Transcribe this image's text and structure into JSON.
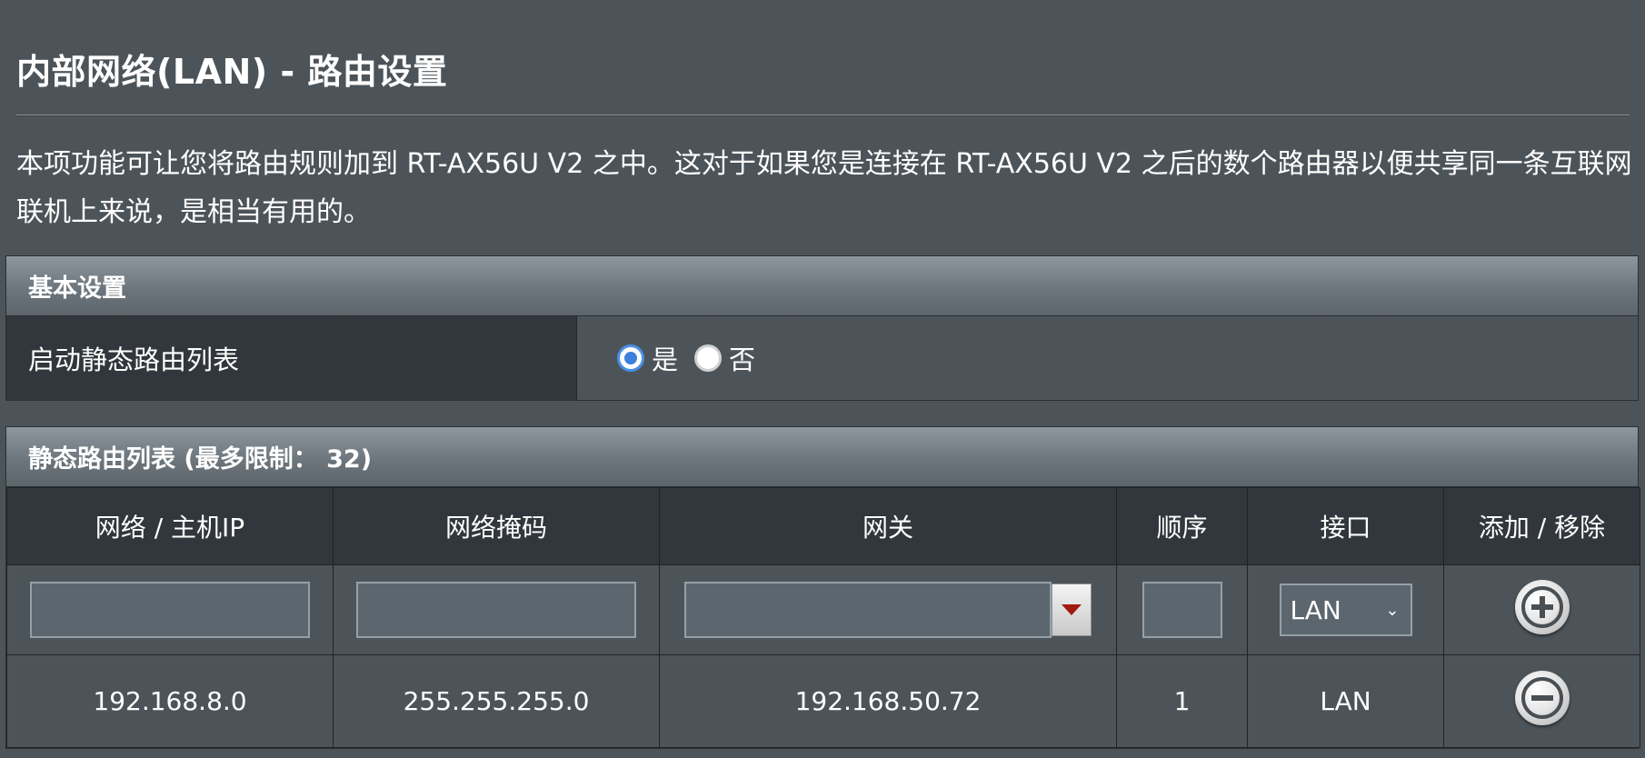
{
  "page": {
    "title": "内部网络(LAN) - 路由设置",
    "description": "本项功能可让您将路由规则加到 RT-AX56U V2 之中。这对于如果您是连接在 RT-AX56U V2 之后的数个路由器以便共享同一条互联网联机上来说，是相当有用的。"
  },
  "basic": {
    "header": "基本设置",
    "enable_label": "启动静态路由列表",
    "options": [
      {
        "label": "是",
        "checked": true
      },
      {
        "label": "否",
        "checked": false
      }
    ]
  },
  "static": {
    "header": "静态路由列表 (最多限制： 32)",
    "columns": [
      "网络 / 主机IP",
      "网络掩码",
      "网关",
      "顺序",
      "接口",
      "添加 / 移除"
    ],
    "input": {
      "network": "",
      "netmask": "",
      "gateway": "",
      "metric": "",
      "interface": "LAN"
    },
    "rows": [
      {
        "network": "192.168.8.0",
        "netmask": "255.255.255.0",
        "gateway": "192.168.50.72",
        "metric": "1",
        "interface": "LAN"
      }
    ]
  },
  "icons": {
    "add": "plus-circle-icon",
    "remove": "minus-circle-icon",
    "dropdown": "triangle-down-icon"
  },
  "colors": {
    "background": "#4d5459",
    "label_bg": "#31373c",
    "radio_selected": "#3f7fdc",
    "dropdown_arrow": "#a11a12"
  }
}
